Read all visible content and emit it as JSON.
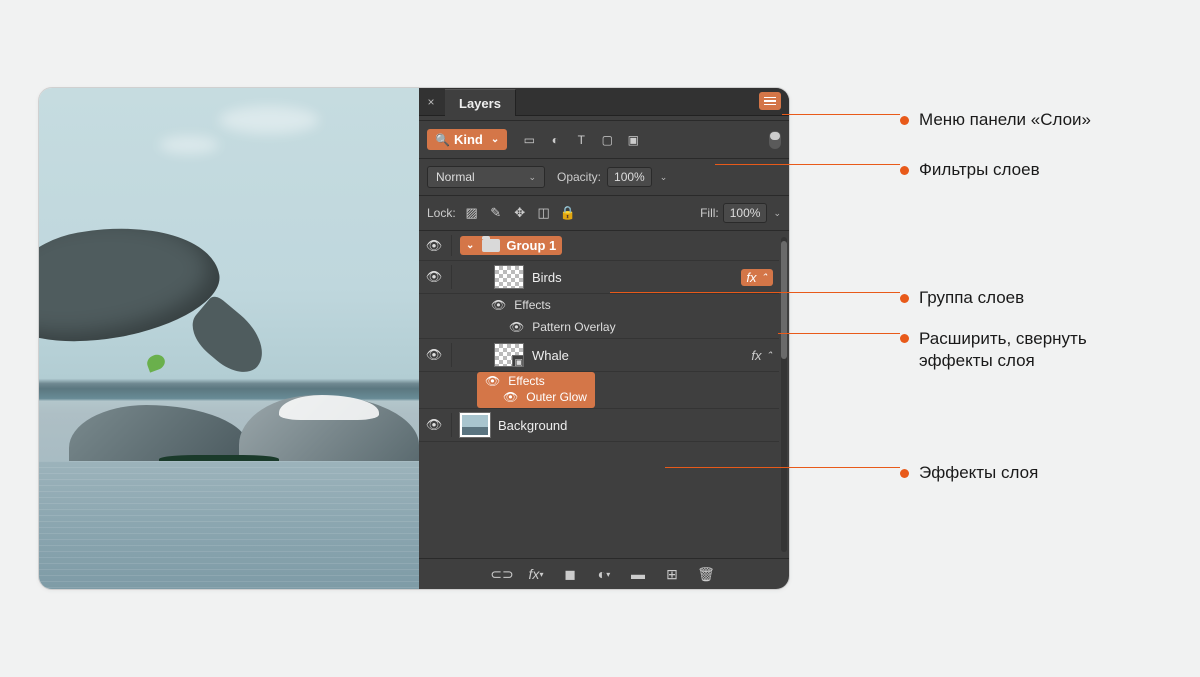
{
  "panel": {
    "tab_title": "Layers",
    "kind_label": "Kind",
    "blend_mode": "Normal",
    "opacity_label": "Opacity:",
    "opacity_value": "100%",
    "lock_label": "Lock:",
    "fill_label": "Fill:",
    "fill_value": "100%"
  },
  "layers": {
    "group_name": "Group 1",
    "birds_name": "Birds",
    "birds_effects_label": "Effects",
    "birds_pattern_label": "Pattern Overlay",
    "whale_name": "Whale",
    "whale_effects_label": "Effects",
    "whale_outerglow_label": "Outer Glow",
    "background_name": "Background",
    "fx_symbol": "fx"
  },
  "annotations": {
    "panel_menu": "Меню панели «Слои»",
    "layer_filters": "Фильтры слоев",
    "layer_group": "Группа слоев",
    "expand_collapse": "Расширить, свернуть эффекты слоя",
    "layer_effects": "Эффекты слоя"
  }
}
